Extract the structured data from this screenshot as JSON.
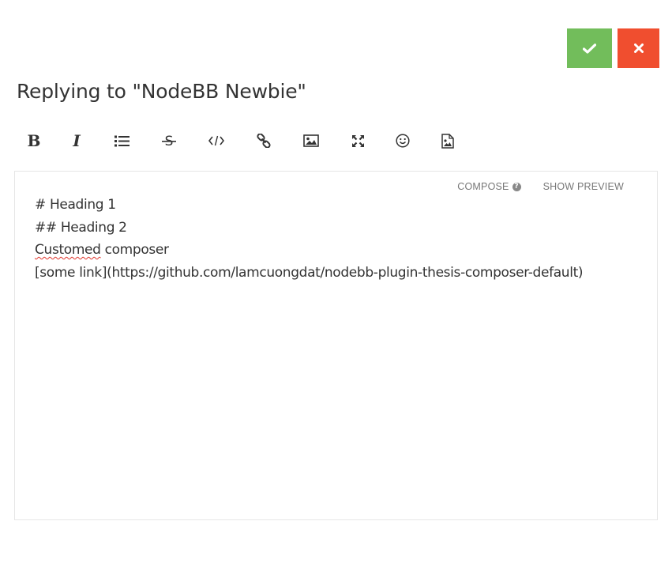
{
  "header": {
    "title": "Replying to \"NodeBB Newbie\""
  },
  "actions": {
    "submit_icon": "check-icon",
    "discard_icon": "close-icon",
    "submit_color": "#72bd5b",
    "discard_color": "#f04e2f"
  },
  "toolbar": {
    "bold_label": "B",
    "italic_label": "I",
    "items": [
      {
        "name": "bold",
        "icon": "bold-icon"
      },
      {
        "name": "italic",
        "icon": "italic-icon"
      },
      {
        "name": "list",
        "icon": "list-icon"
      },
      {
        "name": "strikethrough",
        "icon": "strikethrough-icon"
      },
      {
        "name": "code",
        "icon": "code-icon"
      },
      {
        "name": "link",
        "icon": "link-icon"
      },
      {
        "name": "picture",
        "icon": "image-icon"
      },
      {
        "name": "zen",
        "icon": "expand-icon"
      },
      {
        "name": "emoji",
        "icon": "smile-icon"
      },
      {
        "name": "upload",
        "icon": "file-image-icon"
      }
    ]
  },
  "composer": {
    "compose_tab": "COMPOSE",
    "preview_tab": "SHOW PREVIEW",
    "lines": {
      "line1": "# Heading 1",
      "line2": "## Heading 2",
      "line3_word1": "Customed",
      "line3_rest": " composer",
      "line4": "[some link](https://github.com/lamcuongdat/nodebb-plugin-thesis-composer-default)"
    }
  }
}
